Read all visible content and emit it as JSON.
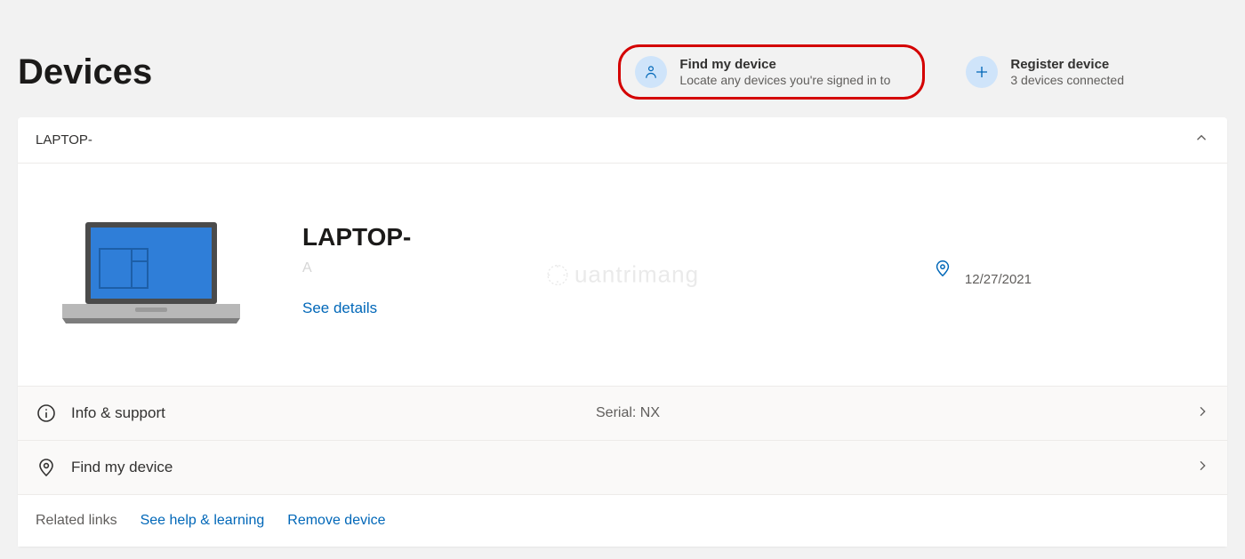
{
  "page": {
    "title": "Devices"
  },
  "actions": {
    "find": {
      "title": "Find my device",
      "subtitle": "Locate any devices you're signed in to"
    },
    "register": {
      "title": "Register device",
      "subtitle": "3 devices connected"
    }
  },
  "device": {
    "header_name": "LAPTOP-",
    "name": "LAPTOP-",
    "subtitle": "A",
    "see_details": "See details",
    "location_date": "12/27/2021"
  },
  "rows": {
    "info_support": {
      "label": "Info & support",
      "serial_prefix": "Serial: NX"
    },
    "find_device": {
      "label": "Find my device"
    }
  },
  "footer": {
    "related": "Related links",
    "help": "See help & learning",
    "remove": "Remove device"
  },
  "watermark": "uantrimang"
}
